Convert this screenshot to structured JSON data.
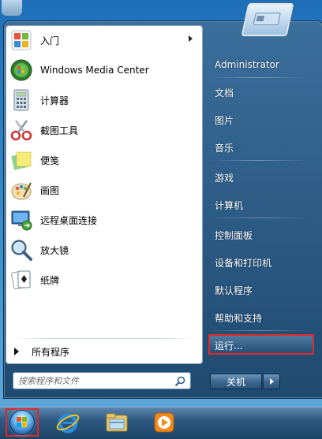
{
  "left_panel": {
    "programs": [
      {
        "label": "入门",
        "icon": "getting-started-icon",
        "has_submenu": true
      },
      {
        "label": "Windows Media Center",
        "icon": "media-center-icon",
        "has_submenu": false
      },
      {
        "label": "计算器",
        "icon": "calculator-icon",
        "has_submenu": false
      },
      {
        "label": "截图工具",
        "icon": "scissors-icon",
        "has_submenu": false
      },
      {
        "label": "便笺",
        "icon": "sticky-notes-icon",
        "has_submenu": false
      },
      {
        "label": "画图",
        "icon": "paint-palette-icon",
        "has_submenu": false
      },
      {
        "label": "远程桌面连接",
        "icon": "remote-desktop-icon",
        "has_submenu": false
      },
      {
        "label": "放大镜",
        "icon": "magnifier-icon",
        "has_submenu": false
      },
      {
        "label": "纸牌",
        "icon": "solitaire-icon",
        "has_submenu": false
      }
    ],
    "all_programs": "所有程序"
  },
  "search": {
    "placeholder": "搜索程序和文件"
  },
  "right_panel": {
    "user": "Administrator",
    "items": [
      "文档",
      "图片",
      "音乐",
      "游戏",
      "计算机",
      "控制面板",
      "设备和打印机",
      "默认程序",
      "帮助和支持"
    ],
    "run": "运行..."
  },
  "shutdown": {
    "label": "关机"
  },
  "taskbar": {
    "icons": [
      "start-orb-icon",
      "internet-explorer-icon",
      "windows-explorer-icon",
      "media-player-icon"
    ]
  },
  "colors": {
    "highlight_border": "#e12929",
    "menu_blue": "#2b5a84",
    "panel_white": "#ffffff"
  }
}
